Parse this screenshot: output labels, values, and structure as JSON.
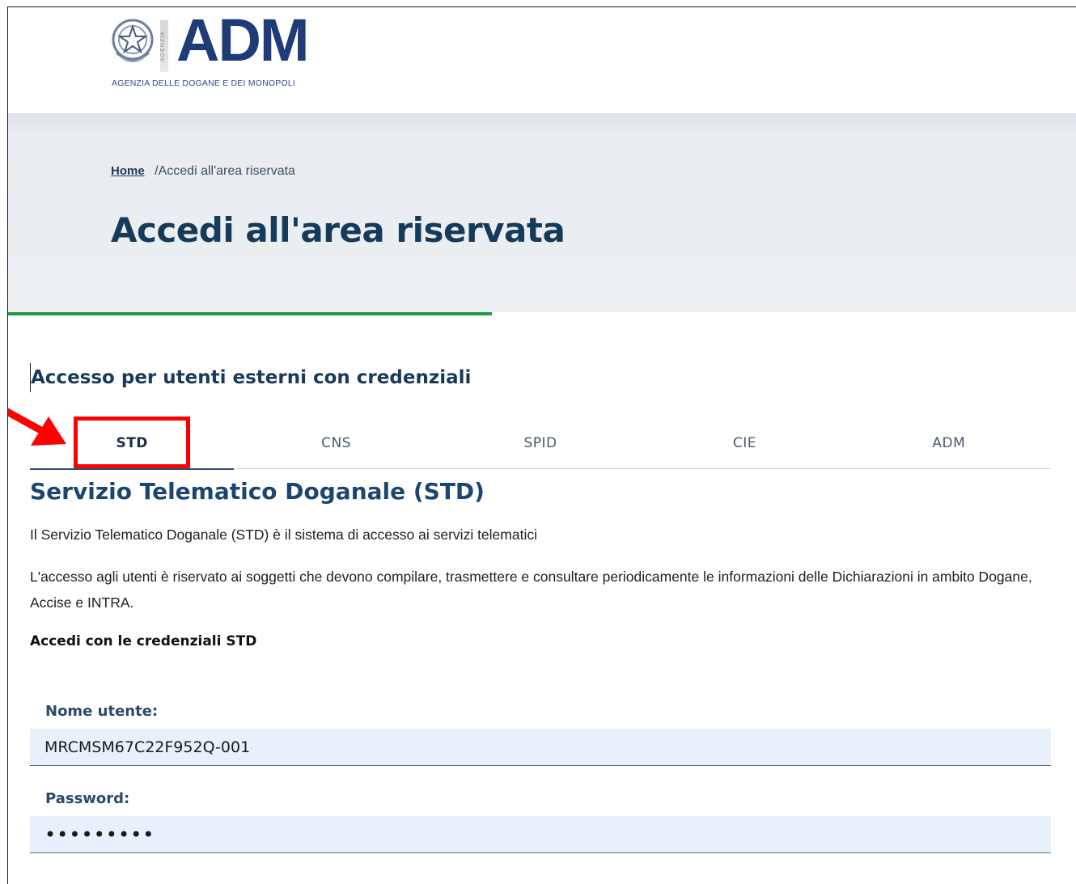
{
  "header": {
    "logo_text": "ADM",
    "logo_subtitle": "AGENZIA DELLE DOGANE E DEI MONOPOLI",
    "logo_vertical": "AGENZIA"
  },
  "breadcrumb": {
    "home": "Home",
    "separator": "/",
    "current": "Accedi all'area riservata"
  },
  "page_title": "Accedi all'area riservata",
  "section_heading": "Accesso per utenti esterni con credenziali",
  "tabs": [
    {
      "label": "STD",
      "active": true
    },
    {
      "label": "CNS",
      "active": false
    },
    {
      "label": "SPID",
      "active": false
    },
    {
      "label": "CIE",
      "active": false
    },
    {
      "label": "ADM",
      "active": false
    }
  ],
  "service": {
    "title": "Servizio Telematico Doganale (STD)",
    "paragraph1": "Il Servizio Telematico Doganale (STD) è il sistema di accesso ai servizi telematici",
    "paragraph2": "L'accesso agli utenti è riservato ai soggetti che devono compilare, trasmettere e consultare periodicamente le informazioni delle Dichiarazioni in ambito Dogane, Accise e INTRA.",
    "login_heading": "Accedi con le credenziali STD"
  },
  "form": {
    "username_label": "Nome utente:",
    "username_value": "MRCMSM67C22F952Q-001",
    "password_label": "Password:",
    "password_value": "•••••••••"
  },
  "colors": {
    "brand_blue": "#1f3b78",
    "accent_green": "#1f9a46",
    "annotation_red": "#ff0000",
    "input_bg": "#e8f0fb"
  }
}
